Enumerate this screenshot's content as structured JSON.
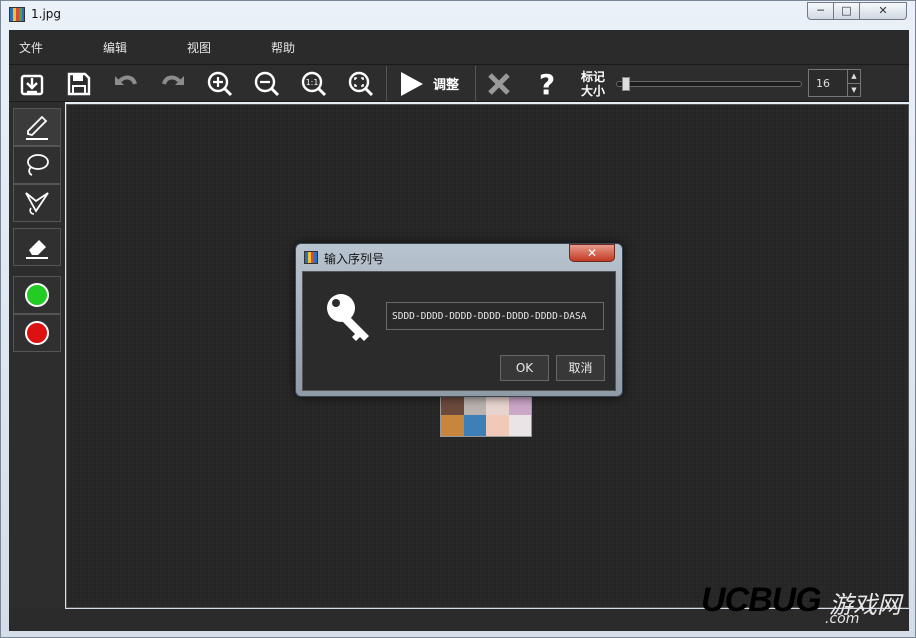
{
  "window": {
    "title": "1.jpg",
    "controls": {
      "minimize": "─",
      "maximize": "□",
      "close": "✕"
    }
  },
  "menu": [
    "文件",
    "编辑",
    "视图",
    "帮助"
  ],
  "toolbar": {
    "icons": [
      "import-icon",
      "save-icon",
      "undo-icon",
      "redo-icon",
      "zoom-in-icon",
      "zoom-out-icon",
      "zoom-actual-icon",
      "zoom-fit-icon"
    ],
    "adjust_label": "调整",
    "mark_size_label": "标记\n大小",
    "mark_size_value": "16",
    "slider_value_fraction": 0.02
  },
  "palette": {
    "tools": [
      "brush-icon",
      "lasso-icon",
      "polygon-lasso-icon",
      "eraser-icon"
    ],
    "colors": [
      "#22cc22",
      "#dd1111"
    ]
  },
  "dialog": {
    "title": "输入序列号",
    "close_label": "✕",
    "serial_value": "SDDD-DDDD-DDDD-DDDD-DDDD-DDDD-DASA",
    "ok_label": "OK",
    "cancel_label": "取消"
  },
  "watermark": {
    "brand": "UCBUG",
    "cn": "游戏网",
    "domain": ".com"
  }
}
